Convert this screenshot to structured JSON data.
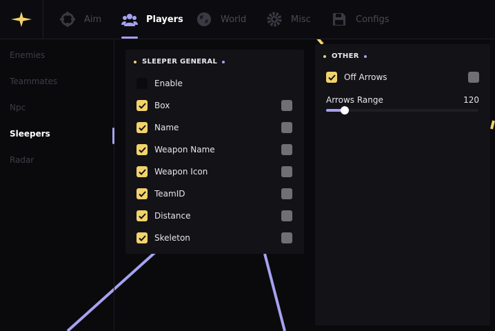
{
  "colors": {
    "accent": "#a6a2f0",
    "yellow": "#f2d36b",
    "swatch": "#6f6f74"
  },
  "tabs": [
    {
      "label": "Aim",
      "icon": "crosshair-icon"
    },
    {
      "label": "Players",
      "icon": "users-icon"
    },
    {
      "label": "World",
      "icon": "globe-icon"
    },
    {
      "label": "Misc",
      "icon": "gear-icon"
    },
    {
      "label": "Configs",
      "icon": "save-icon"
    }
  ],
  "sidebar": {
    "items": [
      "Enemies",
      "Teammates",
      "Npc",
      "Sleepers",
      "Radar"
    ]
  },
  "sleeper_general": {
    "title": "SLEEPER GENERAL",
    "rows": [
      {
        "label": "Enable",
        "checked": false
      },
      {
        "label": "Box",
        "checked": true
      },
      {
        "label": "Name",
        "checked": true
      },
      {
        "label": "Weapon Name",
        "checked": true
      },
      {
        "label": "Weapon Icon",
        "checked": true
      },
      {
        "label": "TeamID",
        "checked": true
      },
      {
        "label": "Distance",
        "checked": true
      },
      {
        "label": "Skeleton",
        "checked": true
      }
    ]
  },
  "other": {
    "title": "OTHER",
    "off_arrows": {
      "label": "Off Arrows",
      "checked": true
    },
    "arrows_range": {
      "label": "Arrows Range",
      "value": "120",
      "fraction": 0.12
    }
  }
}
